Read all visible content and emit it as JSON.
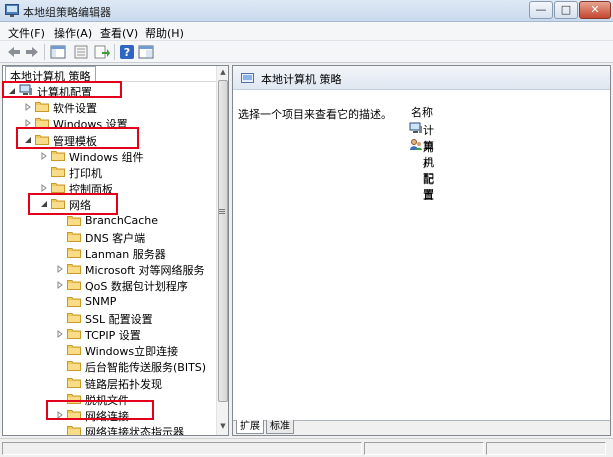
{
  "window": {
    "title": "本地组策略编辑器",
    "min_glyph": "—",
    "max_glyph": "□",
    "close_glyph": "✕"
  },
  "menu": [
    "文件(F)",
    "操作(A)",
    "查看(V)",
    "帮助(H)"
  ],
  "toolbar_icons": [
    "back-icon",
    "forward-icon",
    "show-hide-console-tree-icon",
    "properties-icon",
    "export-list-icon",
    "help-icon",
    "extended-view-icon"
  ],
  "tree": {
    "root_label": "本地计算机 策略",
    "items": [
      {
        "label": "计算机配置",
        "level": 0,
        "arrow": "expanded",
        "icon": "computer-icon",
        "highlighted": true
      },
      {
        "label": "软件设置",
        "level": 1,
        "arrow": "collapsed",
        "icon": "folder-icon"
      },
      {
        "label": "Windows 设置",
        "level": 1,
        "arrow": "collapsed",
        "icon": "folder-icon"
      },
      {
        "label": "管理模板",
        "level": 1,
        "arrow": "expanded",
        "icon": "folder-icon",
        "highlighted": true
      },
      {
        "label": "Windows 组件",
        "level": 2,
        "arrow": "collapsed",
        "icon": "folder-icon"
      },
      {
        "label": "打印机",
        "level": 2,
        "arrow": "none",
        "icon": "folder-icon"
      },
      {
        "label": "控制面板",
        "level": 2,
        "arrow": "collapsed",
        "icon": "folder-icon"
      },
      {
        "label": "网络",
        "level": 2,
        "arrow": "expanded",
        "icon": "folder-icon",
        "highlighted": true
      },
      {
        "label": "BranchCache",
        "level": 3,
        "arrow": "none",
        "icon": "folder-icon"
      },
      {
        "label": "DNS 客户端",
        "level": 3,
        "arrow": "none",
        "icon": "folder-icon"
      },
      {
        "label": "Lanman 服务器",
        "level": 3,
        "arrow": "none",
        "icon": "folder-icon"
      },
      {
        "label": "Microsoft 对等网络服务",
        "level": 3,
        "arrow": "collapsed",
        "icon": "folder-icon"
      },
      {
        "label": "QoS 数据包计划程序",
        "level": 3,
        "arrow": "collapsed",
        "icon": "folder-icon"
      },
      {
        "label": "SNMP",
        "level": 3,
        "arrow": "none",
        "icon": "folder-icon"
      },
      {
        "label": "SSL 配置设置",
        "level": 3,
        "arrow": "none",
        "icon": "folder-icon"
      },
      {
        "label": "TCPIP 设置",
        "level": 3,
        "arrow": "collapsed",
        "icon": "folder-icon"
      },
      {
        "label": "Windows立即连接",
        "level": 3,
        "arrow": "none",
        "icon": "folder-icon"
      },
      {
        "label": "后台智能传送服务(BITS)",
        "level": 3,
        "arrow": "none",
        "icon": "folder-icon"
      },
      {
        "label": "链路层拓扑发现",
        "level": 3,
        "arrow": "none",
        "icon": "folder-icon"
      },
      {
        "label": "脱机文件",
        "level": 3,
        "arrow": "none",
        "icon": "folder-icon"
      },
      {
        "label": "网络连接",
        "level": 3,
        "arrow": "collapsed",
        "icon": "folder-icon",
        "highlighted": true
      },
      {
        "label": "网络连接状态指示器",
        "level": 3,
        "arrow": "none",
        "icon": "folder-icon"
      }
    ]
  },
  "details": {
    "header_title": "本地计算机 策略",
    "description": "选择一个项目来查看它的描述。",
    "column_name": "名称",
    "items": [
      {
        "label": "计算机配置",
        "icon": "computer-icon"
      },
      {
        "label": "用户配置",
        "icon": "user-icon"
      }
    ],
    "tabs": [
      "扩展",
      "标准"
    ]
  },
  "colors": {
    "highlight_box": "#e2001a",
    "folder": "#f2c85b",
    "window_title_bar": "#c9d9ee"
  }
}
